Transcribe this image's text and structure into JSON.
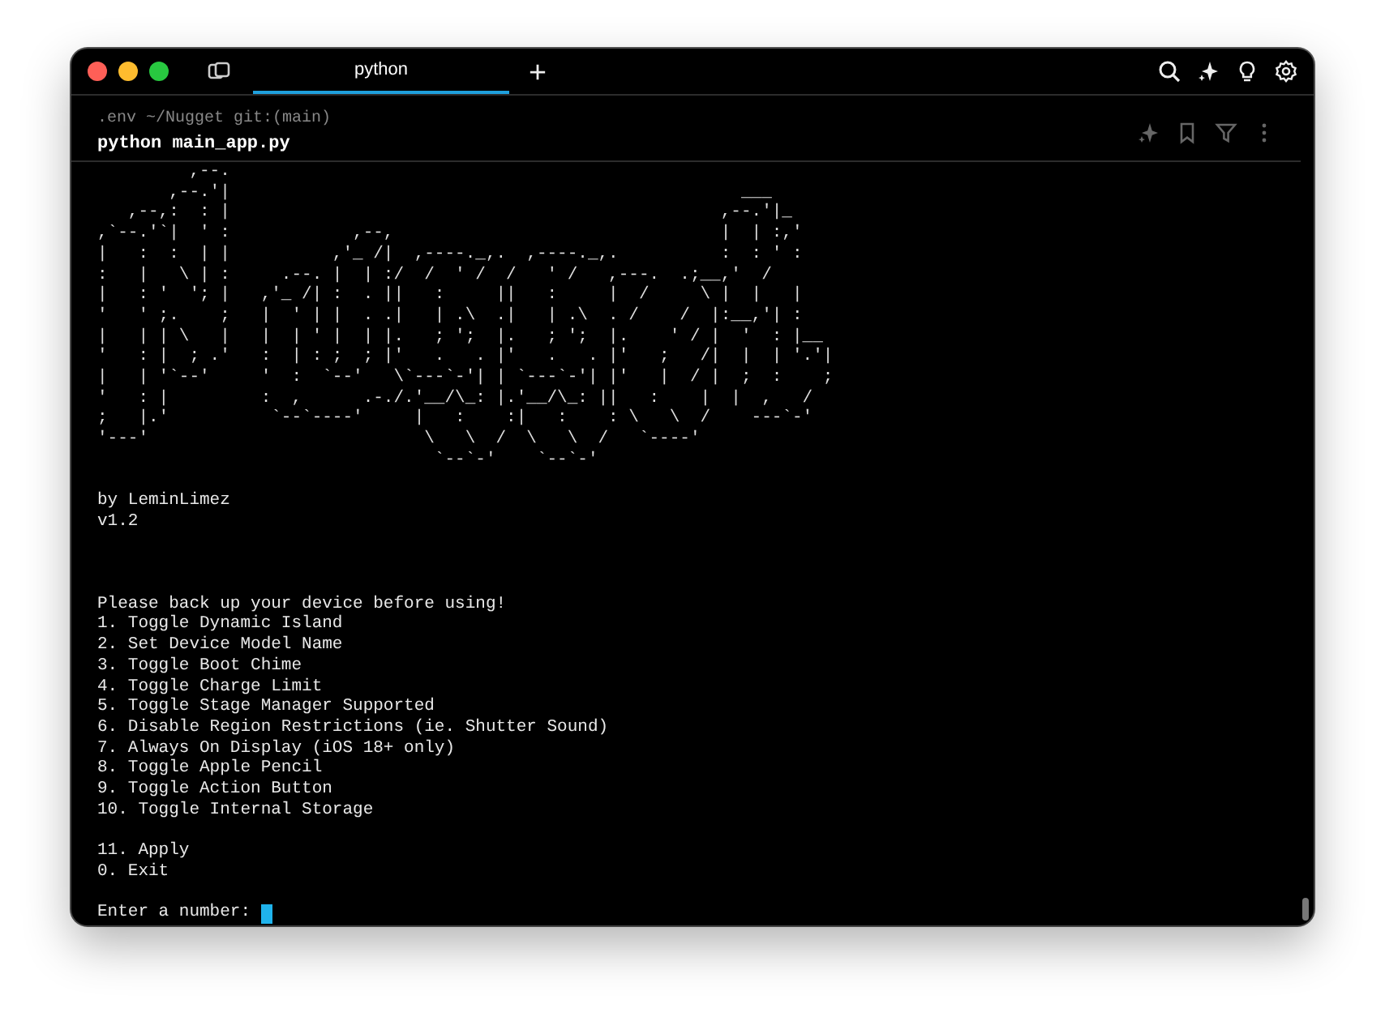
{
  "window": {
    "tabs": [
      {
        "label": "python",
        "selected": true
      }
    ]
  },
  "block": {
    "path": ".env ~/Nugget git:(main)",
    "command": "python main_app.py"
  },
  "output": {
    "banner": [
      "         ,--.",
      "       ,--.'|                                                  ___",
      "   ,--,:  : |                                                ,--.'|_",
      ",`--.'`|  ' :            ,--,                                |  | :,'",
      "|   :  :  | |          ,'_ /|  ,----._,.  ,----._,.          :  : ' :",
      ":   |   \\ | :     .--. |  | :/  /  ' /  /   ' /   ,---.  .;__,'  /",
      "|   : '  '; |   ,'_ /| :  . ||   :     ||   :     |  /     \\ |  |   |",
      "'   ' ;.    ;   |  ' | |  . .|   | .\\  .|   | .\\  . /    /  |:__,'| :",
      "|   | | \\   |   |  | ' |  | |.   ; ';  |.   ; ';  |.    ' / |  '  : |__",
      "'   : |  ; .'   :  | : ;  ; |'   .   . |'   .   . |'   ;   /|  |  | '.'|",
      "|   | '`--'     '  :  `--'   \\`---`-'| | `---`-'| |'   |  / |  ;  :    ;",
      "'   : |         :  ,      .-./.'__/\\_: |.'__/\\_: ||   :    |  |  ,   /",
      ";   |.'          `--`----'     |   :    :|   :    : \\   \\  /    ---`-'",
      "'---'                           \\   \\  /  \\   \\  /   `----'",
      "                                 `--`-'    `--`-'"
    ],
    "credits": [
      "by LeminLimez",
      "v1.2"
    ],
    "notice": "Please back up your device before using!",
    "menu": [
      "1. Toggle Dynamic Island",
      "2. Set Device Model Name",
      "3. Toggle Boot Chime",
      "4. Toggle Charge Limit",
      "5. Toggle Stage Manager Supported",
      "6. Disable Region Restrictions (ie. Shutter Sound)",
      "7. Always On Display (iOS 18+ only)",
      "8. Toggle Apple Pencil",
      "9. Toggle Action Button",
      "10. Toggle Internal Storage"
    ],
    "actions": [
      "11. Apply",
      "0. Exit"
    ],
    "prompt": {
      "label": "Enter a number:"
    }
  }
}
